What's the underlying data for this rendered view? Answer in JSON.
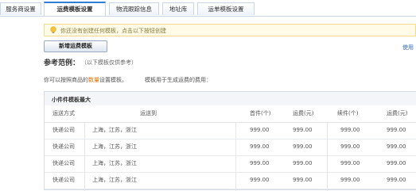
{
  "tabs": [
    {
      "label": "服务商设置",
      "active": false
    },
    {
      "label": "运费模板设置",
      "active": true
    },
    {
      "label": "物流跟踪信息",
      "active": false
    },
    {
      "label": "地址库",
      "active": false
    },
    {
      "label": "运单模板设置",
      "active": false
    }
  ],
  "notice": {
    "text": "你还没有创建任何模板，点击以下按钮创建"
  },
  "add_button": {
    "label": "新增运费模板"
  },
  "help_link": {
    "label": "使用"
  },
  "reference": {
    "title": "参考范例：",
    "subtitle": "（以下模板仅供参考）",
    "desc_prefix": "你可以按照商品的",
    "desc_highlight": "数量",
    "desc_suffix": "设置模板。",
    "desc_tail": "模板用于生成运费的费用："
  },
  "panel": {
    "title": "小件件模板最大",
    "columns": [
      "运送方式",
      "运送到",
      "首件(个)",
      "运费(元)",
      "续件(个)",
      "运费(元)"
    ],
    "rows": [
      [
        "快递公司",
        "上海，江苏，浙江",
        "999.00",
        "999.00",
        "999.00",
        "999.00"
      ],
      [
        "快递公司",
        "上海，江苏，浙江",
        "999.00",
        "999.00",
        "999.00",
        "999.00"
      ],
      [
        "快递公司",
        "上海，江苏，浙江",
        "999.00",
        "999.00",
        "999.00",
        "999.00"
      ],
      [
        "快递公司",
        "上海，江苏，浙江",
        "999.00",
        "999.00",
        "999.00",
        "999.00"
      ]
    ]
  },
  "colors": {
    "accent": "#2f7fd6",
    "warning": "#e07000",
    "notice_bg": "#fffbe6"
  },
  "icons": {
    "notice": "lightbulb-icon"
  }
}
